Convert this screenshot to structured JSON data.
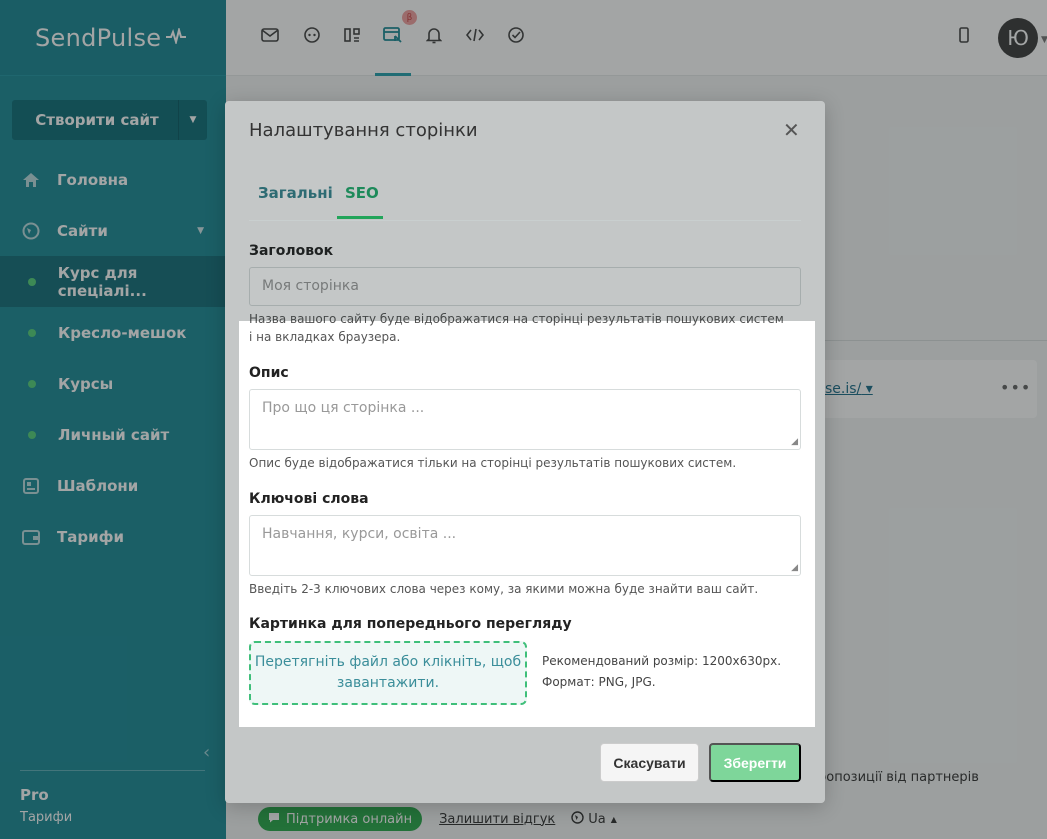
{
  "sidebar": {
    "logo": "SendPulse",
    "create_button": "Створити сайт",
    "items": [
      {
        "label": "Головна"
      },
      {
        "label": "Сайти"
      },
      {
        "label": "Курс для спеціалі..."
      },
      {
        "label": "Кресло-мешок"
      },
      {
        "label": "Курсы"
      },
      {
        "label": "Личный сайт"
      },
      {
        "label": "Шаблони"
      },
      {
        "label": "Тарифи"
      }
    ],
    "plan_name": "Pro",
    "plan_link": "Тарифи"
  },
  "topbar": {
    "beta_badge": "β",
    "avatar_initial": "Ю"
  },
  "background": {
    "site_link": "se.is/",
    "partners_text": "ропозиції від партнерів",
    "support_button": "Підтримка онлайн",
    "feedback_link": "Залишити відгук",
    "language": "Ua"
  },
  "modal": {
    "title": "Налаштування сторінки",
    "tabs": [
      "Загальні",
      "SEO"
    ],
    "fields": {
      "title_label": "Заголовок",
      "title_placeholder": "Моя сторінка",
      "title_help": "Назва вашого сайту буде відображатися на сторінці результатів пошукових систем і на вкладках браузера.",
      "description_label": "Опис",
      "description_placeholder": "Про що ця сторінка ...",
      "description_help": "Опис буде відображатися тільки на сторінці результатів пошукових систем.",
      "keywords_label": "Ключові слова",
      "keywords_placeholder": "Навчання, курси, освіта ...",
      "keywords_help": "Введіть 2-3 ключових слова через кому, за якими можна буде знайти ваш сайт.",
      "preview_label": "Картинка для попереднього перегляду",
      "dropzone_text": "Перетягніть файл або клікніть, щоб завантажити.",
      "recommended_size": "Рекомендований розмір: 1200x630px.",
      "format": "Формат: PNG, JPG."
    },
    "cancel_button": "Скасувати",
    "save_button": "Зберегти"
  },
  "colors": {
    "sidebar_bg": "#1d8a97",
    "accent_green": "#22a55a",
    "save_button": "#7ed69a"
  }
}
